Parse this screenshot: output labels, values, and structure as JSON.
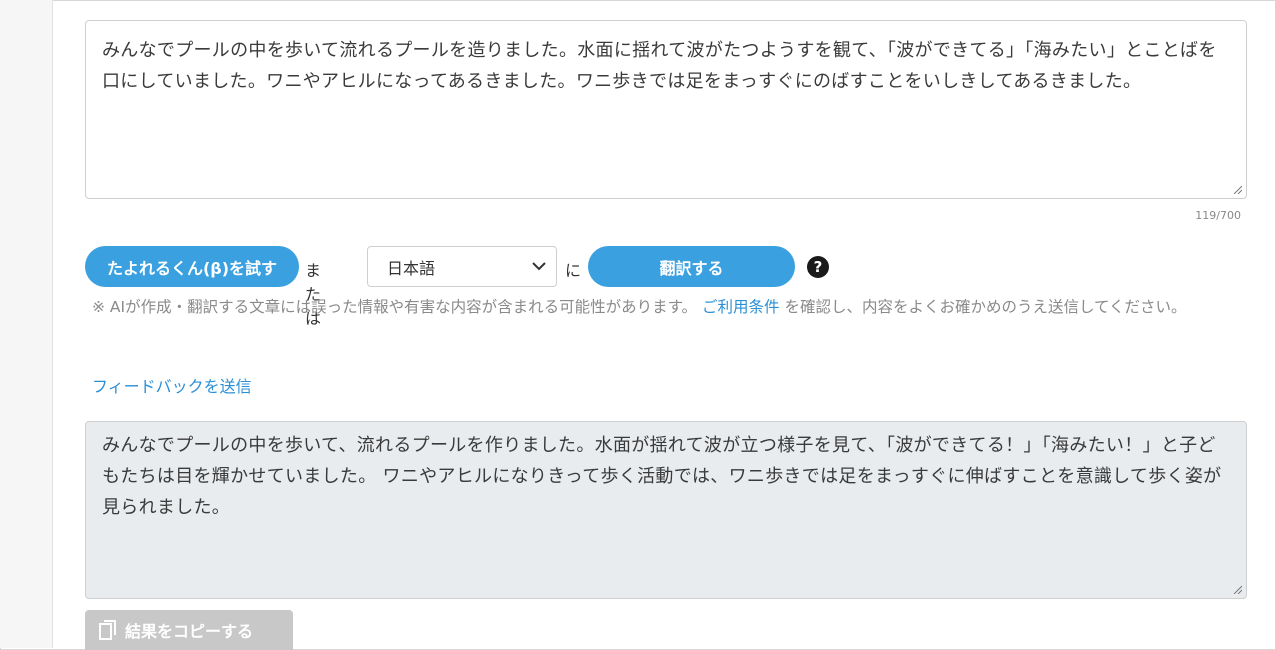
{
  "source": {
    "text": "みんなでプールの中を歩いて流れるプールを造りました。水面に揺れて波がたつようすを観て、「波ができてる」「海みたい」とことばを口にしていました。ワニやアヒルになってあるきました。ワニ歩きでは足をまっすぐにのばすことをいしきしてあるきました。",
    "char_count": "119/700"
  },
  "controls": {
    "ai_button_label": "たよれるくん(β)を試す",
    "or_label": "または",
    "language_selected": "日本語",
    "ni_label": "に",
    "translate_button_label": "翻訳する",
    "help_glyph": "?"
  },
  "disclaimer": {
    "before": "※ AIが作成・翻訳する文章には誤った情報や有害な内容が含まれる可能性があります。",
    "link": "ご利用条件",
    "after": "を確認し、内容をよくお確かめのうえ送信してください。"
  },
  "feedback_link": "フィードバックを送信",
  "result": {
    "text": "みんなでプールの中を歩いて、流れるプールを作りました。水面が揺れて波が立つ様子を見て、「波ができてる！」「海みたい！」と子どもたちは目を輝かせていました。 ワニやアヒルになりきって歩く活動では、ワニ歩きでは足をまっすぐに伸ばすことを意識して歩く姿が見られました。"
  },
  "copy_button_label": "結果をコピーする",
  "colors": {
    "accent": "#3aa0e0",
    "link": "#2b8fd6",
    "result_bg": "#e9ecef",
    "disabled": "#c8c8c8"
  }
}
